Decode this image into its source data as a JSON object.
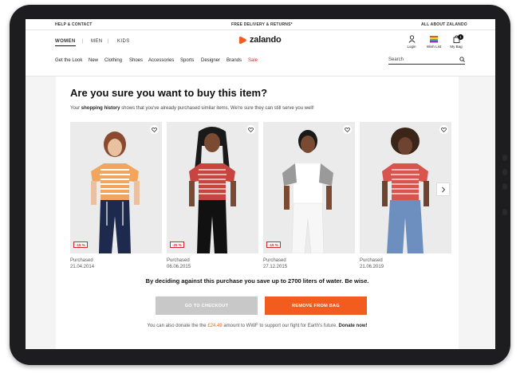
{
  "utility_bar": {
    "help": "HELP & CONTACT",
    "delivery": "FREE DELIVERY & RETURNS*",
    "about": "ALL ABOUT ZALANDO"
  },
  "header": {
    "genders": [
      "WOMEN",
      "MEN",
      "KIDS"
    ],
    "logo_text": "zalando",
    "login_label": "Login",
    "wishlist_label": "Wish List",
    "bag_label": "My Bag",
    "bag_count": "1",
    "nav": [
      "Get the Look",
      "New",
      "Clothing",
      "Shoes",
      "Accessories",
      "Sports",
      "Designer",
      "Brands",
      "Sale"
    ],
    "search_placeholder": "Search"
  },
  "dialog": {
    "title": "Are you sure you want to buy this item?",
    "subtitle_pre": "Your ",
    "subtitle_link": "shopping history",
    "subtitle_post": " shows that you've already purchased similar items. We're sure they can still serve you well!",
    "products": [
      {
        "discount": "-15 %",
        "purchased_label": "Purchased",
        "date": "21.04.2014"
      },
      {
        "discount": "-25 %",
        "purchased_label": "Purchased",
        "date": "06.06.2015"
      },
      {
        "discount": "-15 %",
        "purchased_label": "Purchased",
        "date": "27.12.2015"
      },
      {
        "discount": "",
        "purchased_label": "Purchased",
        "date": "21.06.2019"
      }
    ],
    "water_message": "By deciding against this purchase you save up to 2700 liters of water. Be wise.",
    "checkout_label": "GO TO CHECKOUT",
    "remove_label": "REMOVE FROM BAG",
    "donate_pre": "You can also donate the the ",
    "donate_amount": "£24.49",
    "donate_post": " amount to WWF to support our fight for Earth's future. ",
    "donate_link": "Donate now!"
  },
  "colors": {
    "accent": "#f25c1e",
    "sale": "#d2262e",
    "checkout_disabled": "#c8c8c8"
  }
}
